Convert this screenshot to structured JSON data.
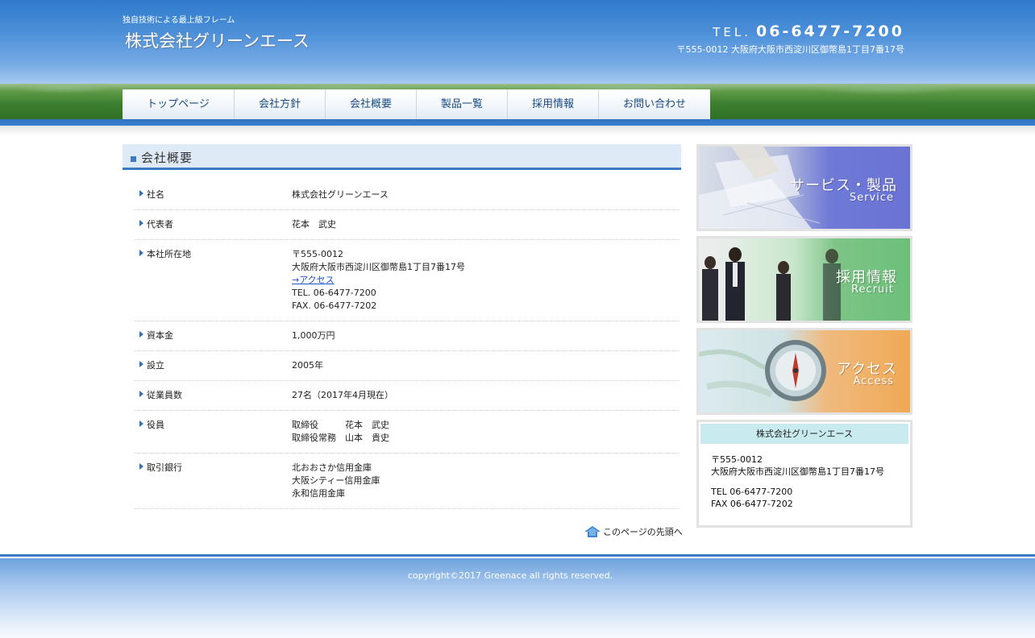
{
  "header": {
    "tagline": "独自技術による最上級フレーム",
    "logo": "株式会社グリーンエース",
    "tel_label": "TEL.",
    "tel_number": "06-6477-7200",
    "address": "〒555-0012 大阪府大阪市西淀川区御幣島1丁目7番17号"
  },
  "nav": [
    {
      "label": "トップページ"
    },
    {
      "label": "会社方針"
    },
    {
      "label": "会社概要"
    },
    {
      "label": "製品一覧"
    },
    {
      "label": "採用情報"
    },
    {
      "label": "お問い合わせ"
    }
  ],
  "main": {
    "section_title": "会社概要",
    "rows": [
      {
        "label": "社名",
        "lines": [
          "株式会社グリーンエース"
        ]
      },
      {
        "label": "代表者",
        "lines": [
          "花本　武史"
        ]
      },
      {
        "label": "本社所在地",
        "lines": [
          "〒555-0012",
          "大阪府大阪市西淀川区御幣島1丁目7番17号"
        ],
        "link": "→アクセス",
        "after_lines": [
          "TEL. 06-6477-7200",
          "FAX. 06-6477-7202"
        ]
      },
      {
        "label": "資本金",
        "lines": [
          "1,000万円"
        ]
      },
      {
        "label": "設立",
        "lines": [
          "2005年"
        ]
      },
      {
        "label": "従業員数",
        "lines": [
          "27名（2017年4月現在）"
        ]
      },
      {
        "label": "役員",
        "lines": [
          "取締役　　　花本　武史",
          "取締役常務　山本　貴史"
        ]
      },
      {
        "label": "取引銀行",
        "lines": [
          "北おおさか信用金庫",
          "大阪シティー信用金庫",
          "永和信用金庫"
        ]
      }
    ],
    "page_top": "このページの先頭へ"
  },
  "sidebar": {
    "banners": [
      {
        "jp": "サービス・製品",
        "en": "Service",
        "color": "#6f79d6"
      },
      {
        "jp": "採用情報",
        "en": "Recruit",
        "color": "#6cc07a"
      },
      {
        "jp": "アクセス",
        "en": "Access",
        "color": "#f0a955"
      }
    ],
    "company_box": {
      "title": "株式会社グリーンエース",
      "postal": "〒555-0012",
      "address": "大阪府大阪市西淀川区御幣島1丁目7番17号",
      "tel": "TEL 06-6477-7200",
      "fax": "FAX 06-6477-7202"
    }
  },
  "footer": {
    "copyright": "copyright©2017 Greenace all rights reserved."
  },
  "colors": {
    "brand_blue": "#3a7ac6",
    "nav_text": "#174a86",
    "box_title_bg": "#c9ebef"
  }
}
